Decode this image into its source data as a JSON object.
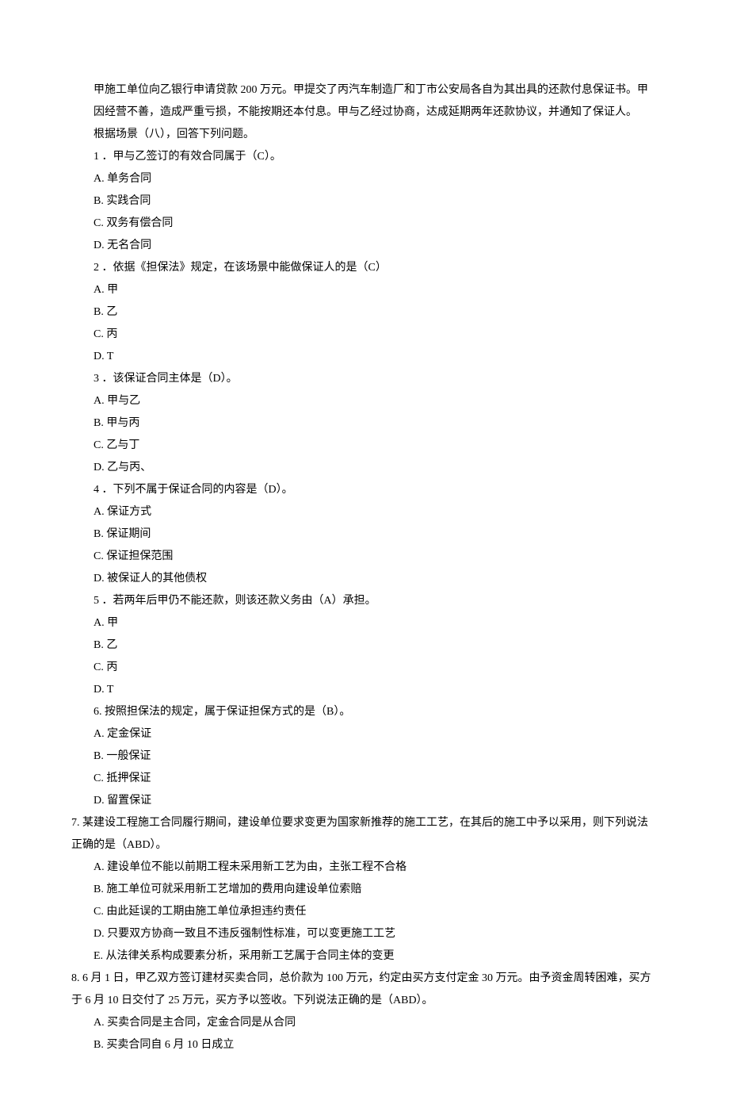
{
  "scenario": {
    "p1": "甲施工单位向乙银行申请贷款 200 万元。甲提交了丙汽车制造厂和丁市公安局各自为其出具的还款付息保证书。甲因经营不善，造成严重亏损，不能按期还本付息。甲与乙经过协商，达成延期两年还款协议，并通知了保证人。",
    "p2": "根据场景（八），回答下列问题。"
  },
  "q1": {
    "stem": "1 ．甲与乙签订的有效合同属于（C）。",
    "a": "A. 单务合同",
    "b": "B. 实践合同",
    "c": "C. 双务有偿合同",
    "d": "D. 无名合同"
  },
  "q2": {
    "stem": "2 ．依据《担保法》规定，在该场景中能做保证人的是（C）",
    "a": "A. 甲",
    "b": "B. 乙",
    "c": "C. 丙",
    "d": "D. T"
  },
  "q3": {
    "stem": "3 ．该保证合同主体是（D）。",
    "a": "A. 甲与乙",
    "b": "B. 甲与丙",
    "c": "C. 乙与丁",
    "d": "D. 乙与丙、"
  },
  "q4": {
    "stem": "4 ．下列不属于保证合同的内容是（D）。",
    "a": "A. 保证方式",
    "b": "B. 保证期间",
    "c": "C. 保证担保范围",
    "d": "D. 被保证人的其他债权"
  },
  "q5": {
    "stem": "5 ．若两年后甲仍不能还款，则该还款义务由（A）承担。",
    "a": "A. 甲",
    "b": "B. 乙",
    "c": "C. 丙",
    "d": "D. T"
  },
  "q6": {
    "stem": "6. 按照担保法的规定，属于保证担保方式的是（B）。",
    "a": "A. 定金保证",
    "b": "B. 一般保证",
    "c": "C. 抵押保证",
    "d": "D. 留置保证"
  },
  "q7": {
    "stem": "7. 某建设工程施工合同履行期间，建设单位要求变更为国家新推荐的施工工艺，在其后的施工中予以采用，则下列说法正确的是（ABD）。",
    "a": "A. 建设单位不能以前期工程未采用新工艺为由，主张工程不合格",
    "b": "B. 施工单位可就采用新工艺增加的费用向建设单位索赔",
    "c": "C. 由此延误的工期由施工单位承担违约责任",
    "d": "D. 只要双方协商一致且不违反强制性标准，可以变更施工工艺",
    "e": "E. 从法律关系构成要素分析，采用新工艺属于合同主体的变更"
  },
  "q8": {
    "stem": "8. 6 月 1 日，甲乙双方签订建材买卖合同，总价款为 100 万元，约定由买方支付定金 30 万元。由予资金周转困难，买方于 6 月 10 日交付了 25 万元，买方予以签收。下列说法正确的是（ABD）。",
    "a": "A. 买卖合同是主合同，定金合同是从合同",
    "b": "B. 买卖合同自 6 月 10 日成立"
  }
}
